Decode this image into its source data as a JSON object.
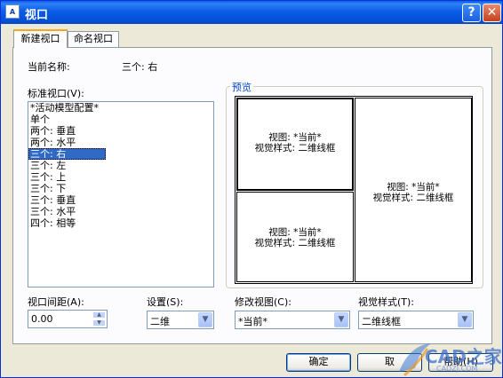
{
  "window": {
    "title": "视口",
    "app_icon_text": "A",
    "help_glyph": "?",
    "close_glyph": "✕"
  },
  "tabs": [
    {
      "label": "新建视口",
      "active": true
    },
    {
      "label": "命名视口",
      "active": false
    }
  ],
  "current_name": {
    "label": "当前名称:",
    "value": "三个: 右"
  },
  "standard_viewports": {
    "label": "标准视口(V):",
    "items": [
      "*活动模型配置*",
      "单个",
      "两个: 垂直",
      "两个: 水平",
      "三个: 右",
      "三个: 左",
      "三个: 上",
      "三个: 下",
      "三个: 垂直",
      "三个: 水平",
      "四个: 相等"
    ],
    "selected_index": 4
  },
  "preview": {
    "label": "预览",
    "viewports": [
      {
        "view": "视图: *当前*",
        "style": "视觉样式: 二维线框"
      },
      {
        "view": "视图: *当前*",
        "style": "视觉样式: 二维线框"
      },
      {
        "view": "视图: *当前*",
        "style": "视觉样式: 二维线框"
      }
    ]
  },
  "spacing": {
    "label": "视口间距(A):",
    "value": "0.00"
  },
  "setup": {
    "label": "设置(S):",
    "value": "二维"
  },
  "change_view": {
    "label": "修改视图(C):",
    "value": "*当前*"
  },
  "visual_style": {
    "label": "视觉样式(T):",
    "value": "二维线框"
  },
  "buttons": {
    "ok": "确定",
    "cancel": "取",
    "help": "帮助(H)"
  },
  "watermark": {
    "text": "CAD之家",
    "sub": "CADZJ.COM"
  },
  "colors": {
    "titlebar": "#0a5ce8",
    "selection": "#316ac5",
    "group_title": "#0046d5"
  }
}
